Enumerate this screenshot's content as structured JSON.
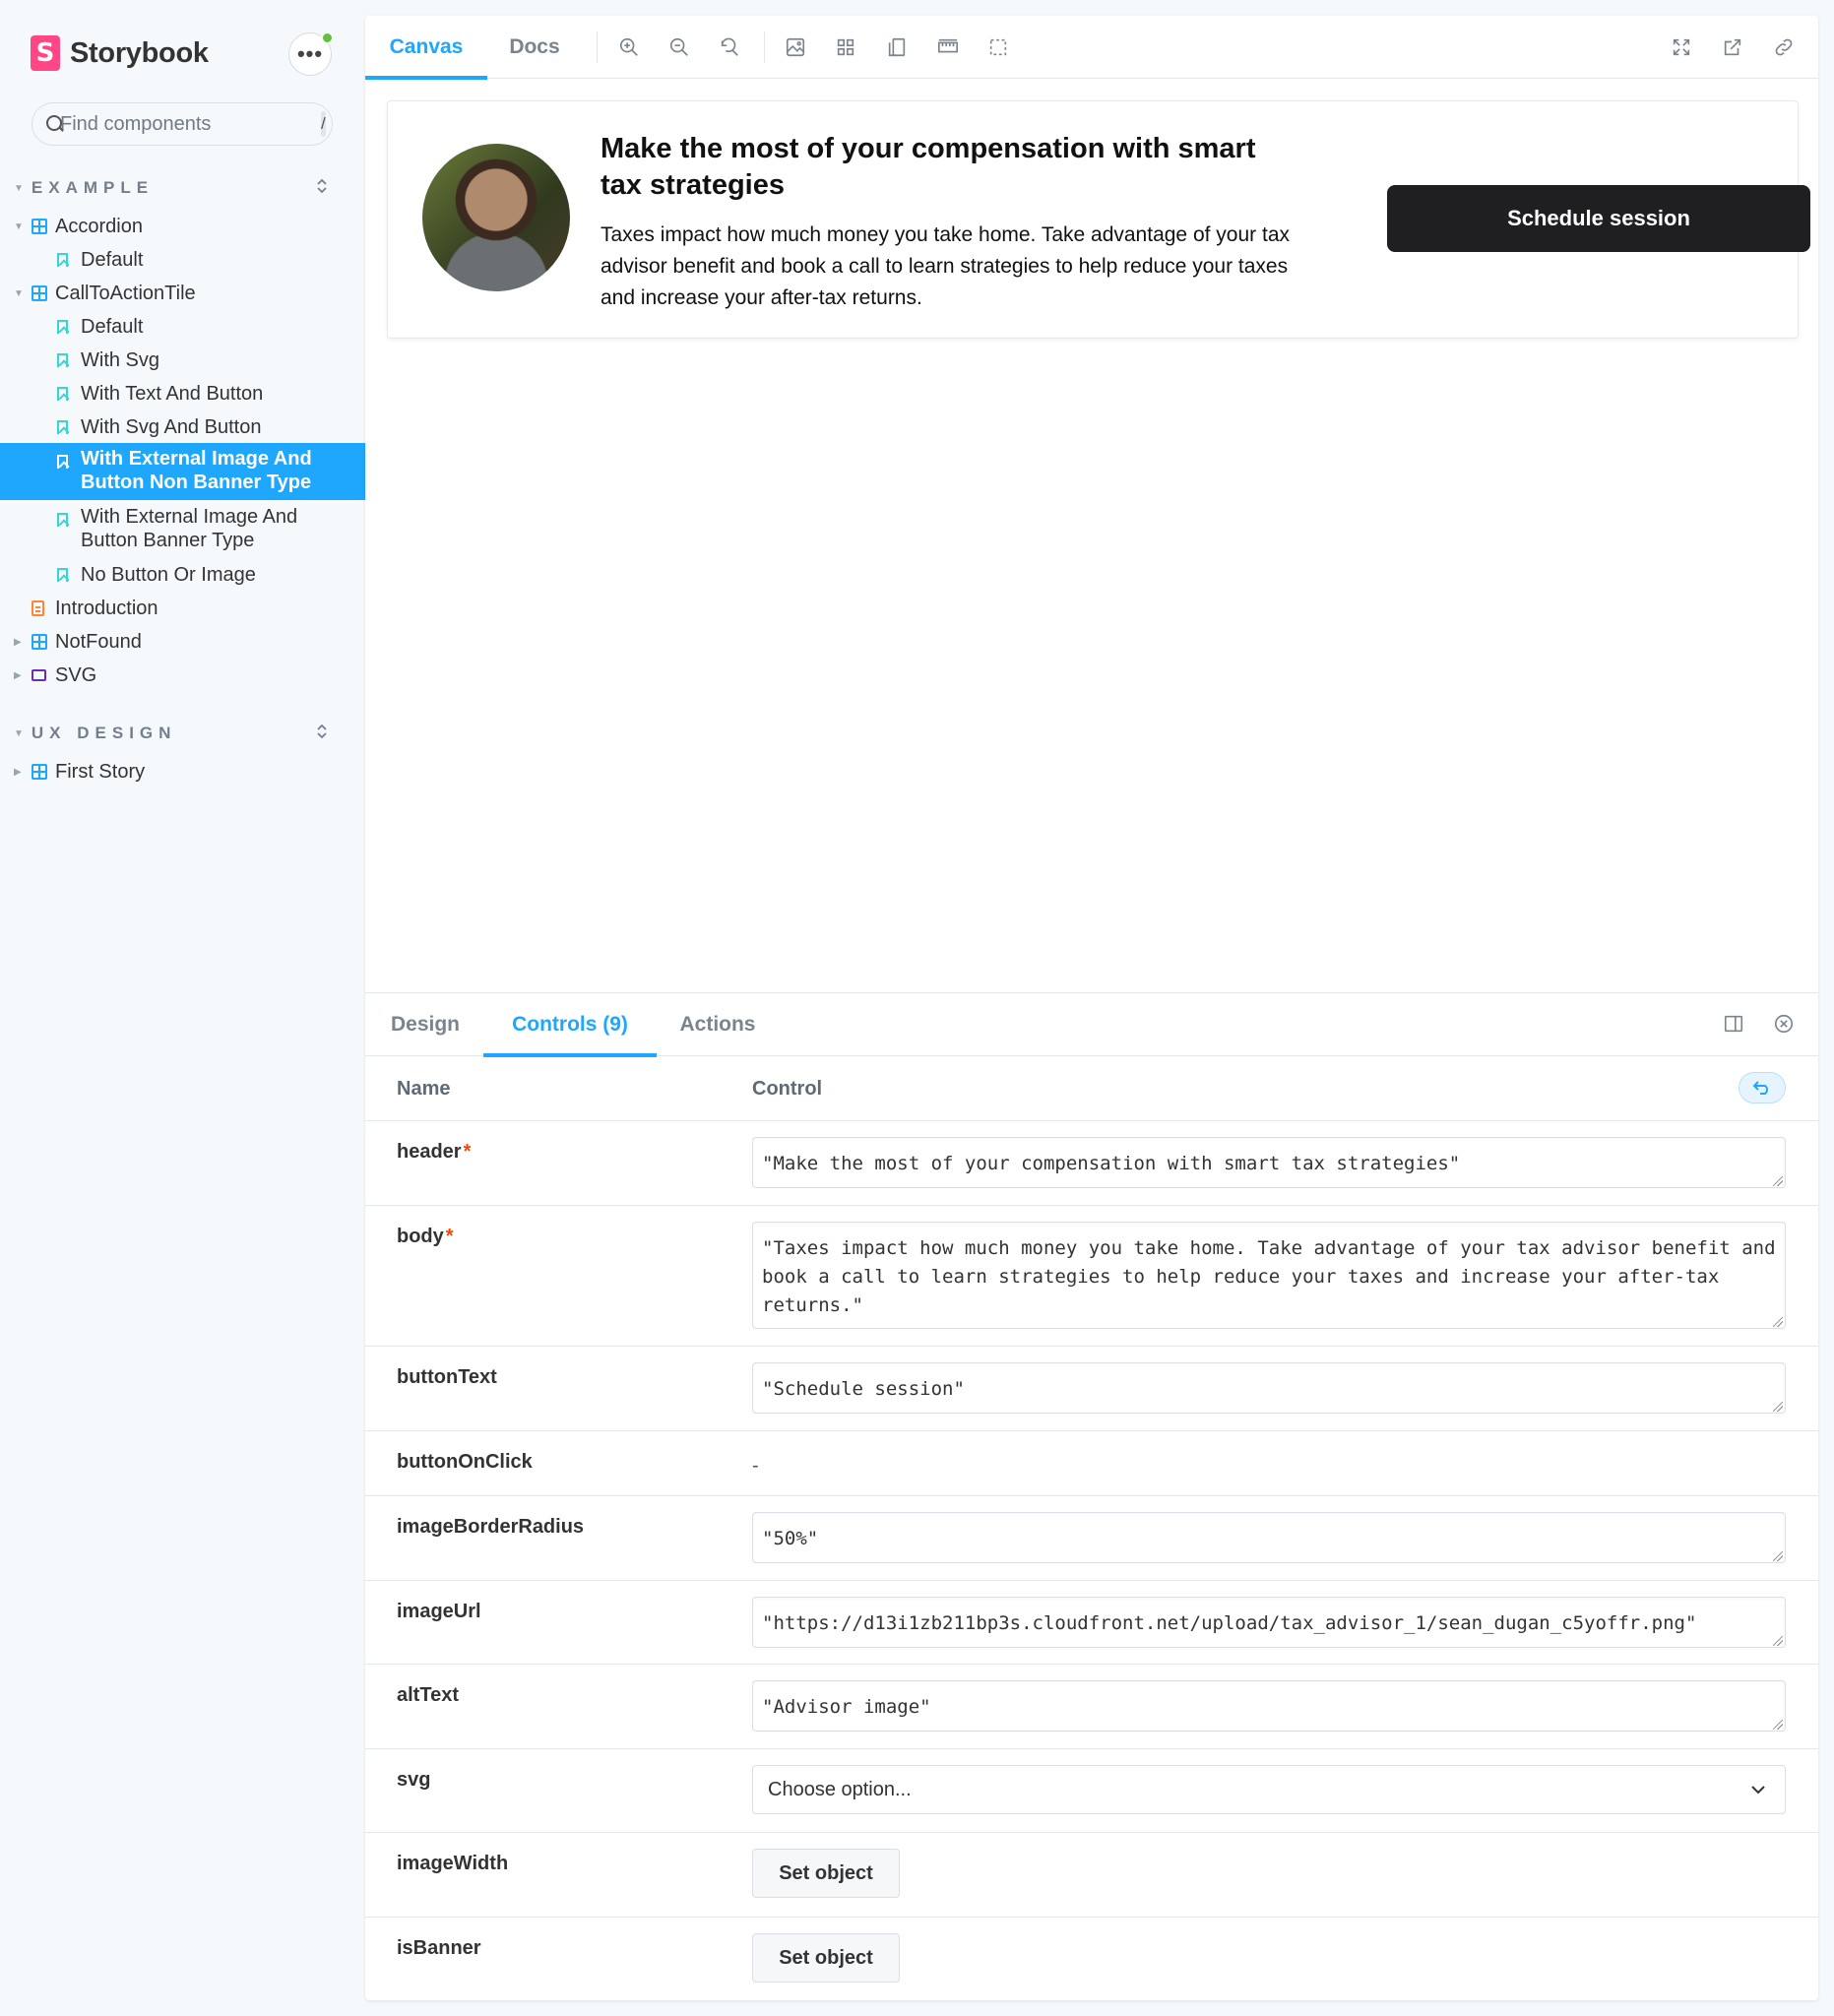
{
  "brand": {
    "logo_letter": "S",
    "name": "Storybook",
    "menu_label": "•••"
  },
  "search": {
    "placeholder": "Find components",
    "shortcut": "/"
  },
  "sidebar": {
    "sections": [
      {
        "title": "EXAMPLE",
        "expand_icon": "⌃⌄"
      },
      {
        "title": "UX DESIGN",
        "expand_icon": "⌃⌄"
      }
    ],
    "items": [
      {
        "label": "Accordion",
        "icon": "component-icon"
      },
      {
        "label": "Default",
        "icon": "bookmark-icon"
      },
      {
        "label": "CallToActionTile",
        "icon": "component-icon"
      },
      {
        "label": "Default",
        "icon": "bookmark-icon"
      },
      {
        "label": "With Svg",
        "icon": "bookmark-icon"
      },
      {
        "label": "With Text And Button",
        "icon": "bookmark-icon"
      },
      {
        "label": "With Svg And Button",
        "icon": "bookmark-icon"
      },
      {
        "label": "With External Image And",
        "label2": "Button Non Banner Type",
        "icon": "bookmark-icon",
        "selected": true
      },
      {
        "label": "With External Image And",
        "label2": "Button Banner Type",
        "icon": "bookmark-icon"
      },
      {
        "label": "No Button Or Image",
        "icon": "bookmark-icon"
      },
      {
        "label": "Introduction",
        "icon": "document-icon"
      },
      {
        "label": "NotFound",
        "icon": "component-icon"
      },
      {
        "label": "SVG",
        "icon": "folder-icon"
      },
      {
        "label": "First Story",
        "icon": "component-icon"
      }
    ]
  },
  "toolbar": {
    "tabs": [
      {
        "label": "Canvas",
        "active": true
      },
      {
        "label": "Docs",
        "active": false
      }
    ],
    "tools": [
      "zoom-in-icon",
      "zoom-out-icon",
      "zoom-reset-icon",
      "background-icon",
      "grid-icon",
      "viewport-icon",
      "measure-icon",
      "outline-icon"
    ],
    "right_tools": [
      "fullscreen-icon",
      "open-new-tab-icon",
      "copy-link-icon"
    ]
  },
  "preview": {
    "title": "Make the most of your compensation with smart tax strategies",
    "body": "Taxes impact how much money you take home. Take advantage of your tax advisor benefit and book a call to learn strategies to help reduce your taxes and increase your after-tax returns.",
    "button": "Schedule session"
  },
  "addons": {
    "tabs": [
      {
        "label": "Design",
        "active": false
      },
      {
        "label": "Controls (9)",
        "active": true
      },
      {
        "label": "Actions",
        "active": false
      }
    ],
    "columns": {
      "name": "Name",
      "control": "Control"
    },
    "rows": {
      "header": {
        "name": "header",
        "required": "*",
        "value": "\"Make the most of your compensation with smart tax strategies\""
      },
      "body": {
        "name": "body",
        "required": "*",
        "value": "\"Taxes impact how much money you take home. Take advantage of your tax advisor benefit and book a call to learn strategies to help reduce your taxes and increase your after-tax returns.\""
      },
      "buttonText": {
        "name": "buttonText",
        "value": "\"Schedule session\""
      },
      "buttonOnClick": {
        "name": "buttonOnClick",
        "value": "-"
      },
      "imageBorderRadius": {
        "name": "imageBorderRadius",
        "value": "\"50%\""
      },
      "imageUrl": {
        "name": "imageUrl",
        "value": "\"https://d13i1zb211bp3s.cloudfront.net/upload/tax_advisor_1/sean_dugan_c5yoffr.png\""
      },
      "altText": {
        "name": "altText",
        "value": "\"Advisor image\""
      },
      "svg": {
        "name": "svg",
        "value": "Choose option..."
      },
      "imageWidth": {
        "name": "imageWidth",
        "value": "Set object"
      },
      "isBanner": {
        "name": "isBanner",
        "value": "Set object"
      }
    }
  },
  "colors": {
    "accent": "#1ea7fd",
    "brand": "#ff4785",
    "required": "#ff4400",
    "status": "#66bf3c",
    "button_dark": "#1f1f22"
  }
}
